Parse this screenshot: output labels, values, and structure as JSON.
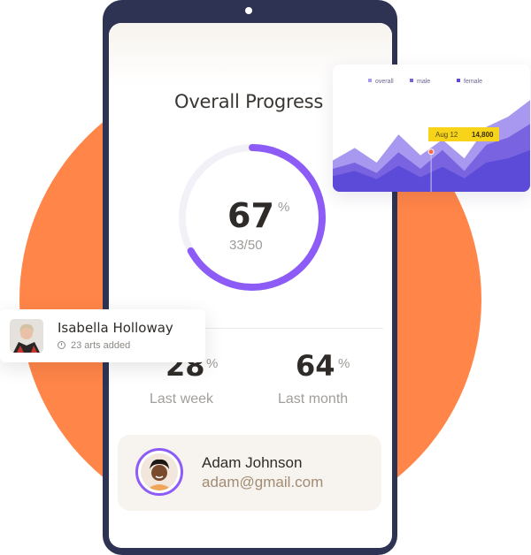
{
  "dashboard": {
    "title": "Overall Progress",
    "progress": {
      "percent": 67,
      "percent_unit": "%",
      "ratio": "33/50",
      "ring_color": "#8d5cf6"
    },
    "stats": [
      {
        "value": "28",
        "unit": "%",
        "label": "Last week"
      },
      {
        "value": "64",
        "unit": "%",
        "label": "Last month"
      }
    ],
    "user": {
      "name": "Adam Johnson",
      "email": "adam@gmail.com",
      "avatar_icon": "person-avatar-icon"
    }
  },
  "chart_card": {
    "legend": [
      "overall",
      "male",
      "female"
    ],
    "tooltip": {
      "date": "Aug 12",
      "value": "14,800"
    },
    "colors": {
      "overall": "#a898ef",
      "male": "#7a63e0",
      "female": "#5b4bd8",
      "tooltip": "#f7d31a"
    }
  },
  "chart_data": {
    "type": "area",
    "title": "",
    "series": [
      {
        "name": "overall",
        "values": [
          30,
          42,
          28,
          55,
          35,
          50,
          32,
          62,
          72,
          88
        ]
      },
      {
        "name": "male",
        "values": [
          22,
          28,
          18,
          38,
          22,
          40,
          20,
          45,
          52,
          65
        ]
      },
      {
        "name": "female",
        "values": [
          15,
          20,
          12,
          25,
          14,
          24,
          13,
          28,
          32,
          40
        ]
      }
    ]
  },
  "profile_card": {
    "name": "Isabella Holloway",
    "subtitle": "23 arts added",
    "avatar_icon": "person-avatar-icon"
  }
}
